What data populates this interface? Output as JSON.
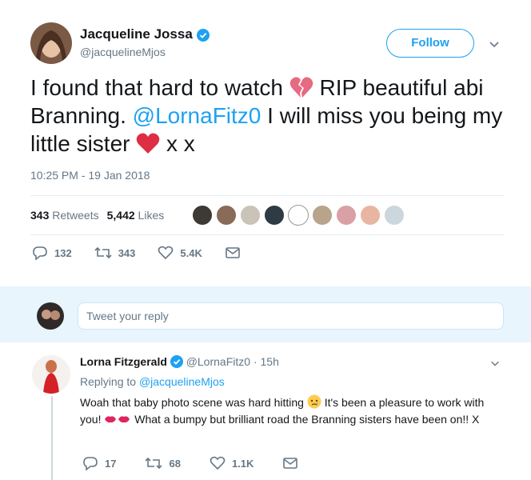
{
  "tweet": {
    "author_name": "Jacqueline Jossa",
    "author_handle": "@jacquelineMjos",
    "follow_label": "Follow",
    "text_part1": "I found that hard to watch",
    "text_part2": "RIP beautiful abi Branning.",
    "mention": "@LornaFitz0",
    "text_part3": "I will miss you being my little sister",
    "text_part4": "x x",
    "timestamp": "10:25 PM - 19 Jan 2018",
    "retweets_count": "343",
    "retweets_label": "Retweets",
    "likes_count": "5,442",
    "likes_label": "Likes",
    "actions": {
      "replies": "132",
      "retweets": "343",
      "likes": "5.4K"
    },
    "emoji": [
      "broken-heart",
      "red-heart"
    ]
  },
  "reply_box": {
    "placeholder": "Tweet your reply"
  },
  "reply_tweet": {
    "author_name": "Lorna Fitzgerald",
    "author_handle": "@LornaFitz0",
    "separator": "·",
    "age": "15h",
    "replying_prefix": "Replying to",
    "replying_handle": "@jacquelineMjos",
    "text_part1": "Woah that baby photo scene was hard hitting",
    "text_part2": "It's been a pleasure to work with you!",
    "text_part3": "What a bumpy but brilliant road the Branning sisters have been on!! X",
    "emoji": [
      "crying-face",
      "kiss-mark",
      "kiss-mark"
    ],
    "actions": {
      "replies": "17",
      "retweets": "68",
      "likes": "1.1K"
    }
  },
  "colors": {
    "accent": "#1da1f2",
    "muted": "#657786",
    "heart": "#e0245e",
    "reply_bar_bg": "#e8f5fd"
  }
}
